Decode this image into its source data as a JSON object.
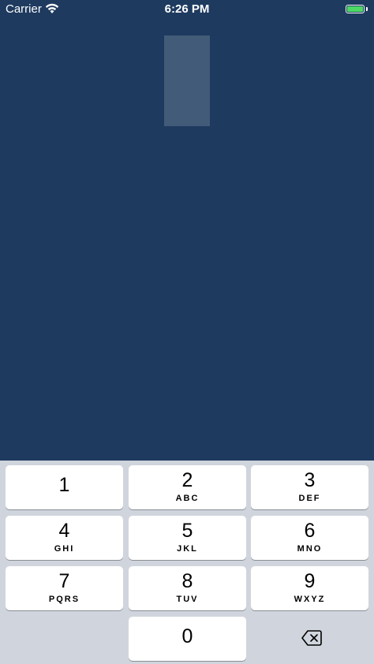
{
  "status_bar": {
    "carrier": "Carrier",
    "time": "6:26 PM",
    "battery_color": "#4cd964"
  },
  "keypad": {
    "keys": [
      {
        "digit": "1",
        "letters": ""
      },
      {
        "digit": "2",
        "letters": "ABC"
      },
      {
        "digit": "3",
        "letters": "DEF"
      },
      {
        "digit": "4",
        "letters": "GHI"
      },
      {
        "digit": "5",
        "letters": "JKL"
      },
      {
        "digit": "6",
        "letters": "MNO"
      },
      {
        "digit": "7",
        "letters": "PQRS"
      },
      {
        "digit": "8",
        "letters": "TUV"
      },
      {
        "digit": "9",
        "letters": "WXYZ"
      },
      {
        "digit": "0",
        "letters": ""
      }
    ],
    "delete_icon": "delete-backward-icon"
  },
  "colors": {
    "background": "#1e3a5f",
    "input_box": "#425b78",
    "keypad_bg": "#d0d5dd"
  }
}
